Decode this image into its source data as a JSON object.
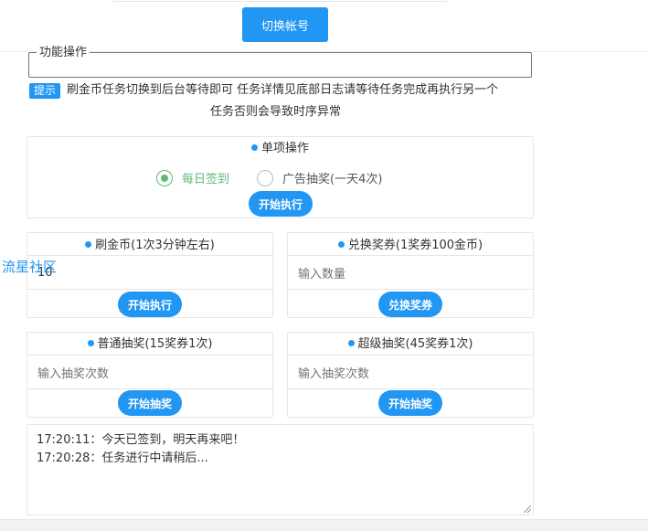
{
  "header": {
    "switch_account_label": "切换帐号"
  },
  "function_section": {
    "legend": "功能操作"
  },
  "tip": {
    "badge": "提示",
    "line1": "刷金币任务切换到后台等待即可 任务详情见底部日志请等待任务完成再执行另一个",
    "line2": "任务否则会导致时序异常"
  },
  "single_op": {
    "title": "单项操作",
    "options": [
      {
        "label": "每日签到",
        "checked": true
      },
      {
        "label": "广告抽奖(一天4次)",
        "checked": false
      }
    ],
    "start_label": "开始执行"
  },
  "coin": {
    "title": "刷金币(1次3分钟左右)",
    "value": "10",
    "start_label": "开始执行"
  },
  "exchange": {
    "title": "兑换奖券(1奖券100金币)",
    "placeholder": "输入数量",
    "button_label": "兑换奖券"
  },
  "normal_lottery": {
    "title": "普通抽奖(15奖券1次)",
    "placeholder": "输入抽奖次数",
    "button_label": "开始抽奖"
  },
  "super_lottery": {
    "title": "超级抽奖(45奖券1次)",
    "placeholder": "输入抽奖次数",
    "button_label": "开始抽奖"
  },
  "watermark": "流星社区",
  "log": {
    "lines": [
      "17:20:11：今天已签到，明天再来吧！",
      "17:20:28：任务进行中请稍后..."
    ]
  },
  "colors": {
    "primary": "#2196f3",
    "radio_checked": "#5fb878"
  }
}
